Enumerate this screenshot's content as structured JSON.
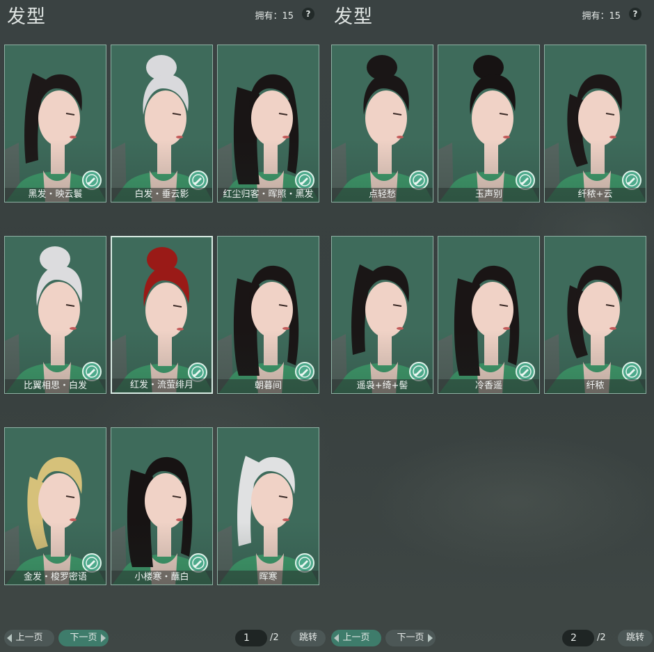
{
  "panels": [
    {
      "title": "发型",
      "owned": "拥有：15",
      "help": "?",
      "items": [
        {
          "name": "黑发・映云鬟",
          "hair": "#1d1818",
          "style": "ponytail"
        },
        {
          "name": "白发・垂云影",
          "hair": "#d9d9dc",
          "style": "bun"
        },
        {
          "name": "红尘归客・晖照・黑发",
          "hair": "#191515",
          "style": "long"
        },
        {
          "name": "比翼相思・白发",
          "hair": "#dcdcde",
          "style": "bun"
        },
        {
          "name": "红发・流萤绯月",
          "hair": "#9a1a17",
          "style": "bun"
        },
        {
          "name": "朝暮间",
          "hair": "#1a1515",
          "style": "long"
        },
        {
          "name": "金发・梭罗密语",
          "hair": "#d6c17a",
          "style": "short"
        },
        {
          "name": "小楼寒・蘸白",
          "hair": "#171313",
          "style": "long"
        },
        {
          "name": "晖寒",
          "hair": "#e0e1e2",
          "style": "ponytail"
        }
      ],
      "selected_index": 4,
      "pager": {
        "prev": "上一页",
        "next": "下一页",
        "page": "1",
        "total": "/2",
        "jump": "跳转",
        "active": "next"
      }
    },
    {
      "title": "发型",
      "owned": "拥有：15",
      "help": "?",
      "items": [
        {
          "name": "点轻愁",
          "hair": "#1a1616",
          "style": "bun"
        },
        {
          "name": "玉声别",
          "hair": "#171313",
          "style": "bun"
        },
        {
          "name": "纤秾+云",
          "hair": "#1c1717",
          "style": "short"
        },
        {
          "name": "遥袅+绮+髻",
          "hair": "#1a1616",
          "style": "ponytail"
        },
        {
          "name": "冷香遥",
          "hair": "#1a1515",
          "style": "long"
        },
        {
          "name": "纤秾",
          "hair": "#1c1717",
          "style": "short"
        }
      ],
      "selected_index": -1,
      "pager": {
        "prev": "上一页",
        "next": "下一页",
        "page": "2",
        "total": "/2",
        "jump": "跳转",
        "active": "prev"
      }
    }
  ]
}
